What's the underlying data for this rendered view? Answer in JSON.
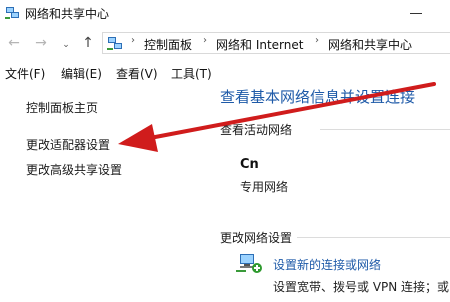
{
  "window": {
    "title": "网络和共享中心"
  },
  "nav": {
    "back": "←",
    "forward": "→",
    "recent": "⌄",
    "up": "↑"
  },
  "address": {
    "crumbs": [
      "控制面板",
      "网络和 Internet",
      "网络和共享中心"
    ],
    "separator": "›"
  },
  "menu": {
    "items": [
      "文件(F)",
      "编辑(E)",
      "查看(V)",
      "工具(T)"
    ]
  },
  "sidebar": {
    "items": [
      {
        "label": "控制面板主页"
      },
      {
        "label": "更改适配器设置"
      },
      {
        "label": "更改高级共享设置"
      }
    ]
  },
  "main": {
    "title": "查看基本网络信息并设置连接",
    "active_networks_heading": "查看活动网络",
    "network": {
      "name": "Cn",
      "type": "专用网络"
    },
    "change_settings_heading": "更改网络设置",
    "task": {
      "link": "设置新的连接或网络",
      "description": "设置宽带、拨号或 VPN 连接；或"
    }
  },
  "colors": {
    "link": "#1e5aa8",
    "annotation_arrow": "#d01c1c",
    "background": "#ffffff"
  },
  "icons": {
    "window": "network-center-icon",
    "address": "network-center-icon",
    "task": "network-setup-icon"
  }
}
